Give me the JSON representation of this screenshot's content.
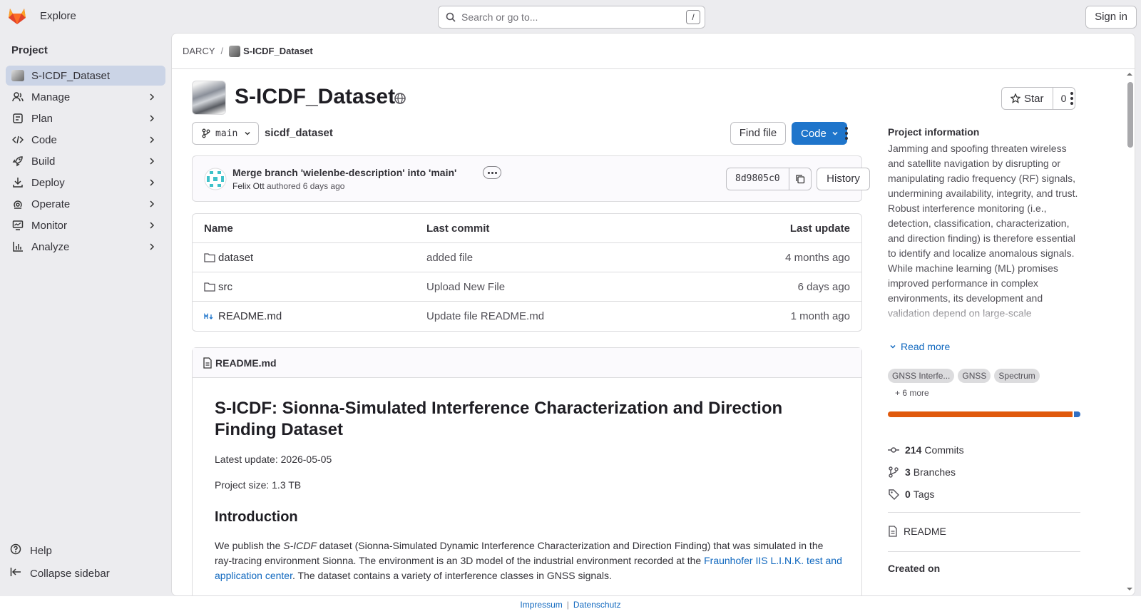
{
  "topbar": {
    "explore_label": "Explore",
    "search_placeholder": "Search or go to...",
    "search_shortcut": "/",
    "signin_label": "Sign in"
  },
  "sidebar": {
    "section_title": "Project",
    "project_name": "S-ICDF_Dataset",
    "items": [
      {
        "label": "Manage",
        "icon": "manage-icon"
      },
      {
        "label": "Plan",
        "icon": "plan-icon"
      },
      {
        "label": "Code",
        "icon": "code-icon"
      },
      {
        "label": "Build",
        "icon": "rocket-icon"
      },
      {
        "label": "Deploy",
        "icon": "deploy-icon"
      },
      {
        "label": "Operate",
        "icon": "operate-icon"
      },
      {
        "label": "Monitor",
        "icon": "monitor-icon"
      },
      {
        "label": "Analyze",
        "icon": "chart-icon"
      }
    ],
    "help_label": "Help",
    "collapse_label": "Collapse sidebar"
  },
  "breadcrumb": {
    "group": "DARCY",
    "project": "S-ICDF_Dataset"
  },
  "project": {
    "title": "S-ICDF_Dataset",
    "star_label": "Star",
    "star_count": "0",
    "branch": "main",
    "path": "sicdf_dataset",
    "find_file_label": "Find file",
    "code_label": "Code"
  },
  "last_commit": {
    "message": "Merge branch 'wielenbe-description' into 'main'",
    "author": "Felix Ott",
    "action": "authored",
    "when": "6 days ago",
    "sha": "8d9805c0",
    "history_label": "History"
  },
  "file_table": {
    "headers": {
      "name": "Name",
      "commit": "Last commit",
      "update": "Last update"
    },
    "rows": [
      {
        "name": "dataset",
        "type": "folder",
        "commit": "added file",
        "update": "4 months ago"
      },
      {
        "name": "src",
        "type": "folder",
        "commit": "Upload New File",
        "update": "6 days ago"
      },
      {
        "name": "README.md",
        "type": "markdown",
        "commit": "Update file README.md",
        "update": "1 month ago"
      }
    ]
  },
  "readme": {
    "filename": "README.md",
    "h1": "S-ICDF: Sionna-Simulated Interference Characterization and Direction Finding Dataset",
    "latest_update": "Latest update: 2026-05-05",
    "project_size": "Project size: 1.3 TB",
    "intro_heading": "Introduction",
    "intro_pre": "We publish the ",
    "intro_em": "S-ICDF",
    "intro_mid": " dataset (Sionna-Simulated Dynamic Interference Characterization and Direction Finding) that was simulated in the ray-tracing environment Sionna. The environment is an 3D model of the industrial environment recorded at the ",
    "intro_link": "Fraunhofer IIS L.I.N.K. test and application center",
    "intro_post": ". The dataset contains a variety of interference classes in GNSS signals."
  },
  "project_info": {
    "title": "Project information",
    "description": "Jamming and spoofing threaten wireless and satellite navigation by disrupting or manipulating radio frequency (RF) signals, undermining availability, integrity, and trust. Robust interference monitoring (i.e., detection, classification, characterization, and direction finding) is therefore essential to identify and localize anomalous signals. While machine learning (ML) promises improved performance in complex environments, its development and validation depend on large-scale",
    "read_more": "Read more",
    "topics": [
      "GNSS Interfe...",
      "GNSS",
      "Spectrum"
    ],
    "more_topics": "+ 6 more",
    "languages": [
      {
        "share": 0.965,
        "color": "#e0590c"
      },
      {
        "share": 0.035,
        "color": "#2f6fc4"
      }
    ],
    "commits_count": "214",
    "commits_label": "Commits",
    "branches_count": "3",
    "branches_label": "Branches",
    "tags_count": "0",
    "tags_label": "Tags",
    "readme_link": "README",
    "created_on_label": "Created on"
  },
  "footer": {
    "impressum": "Impressum",
    "datenschutz": "Datenschutz"
  }
}
